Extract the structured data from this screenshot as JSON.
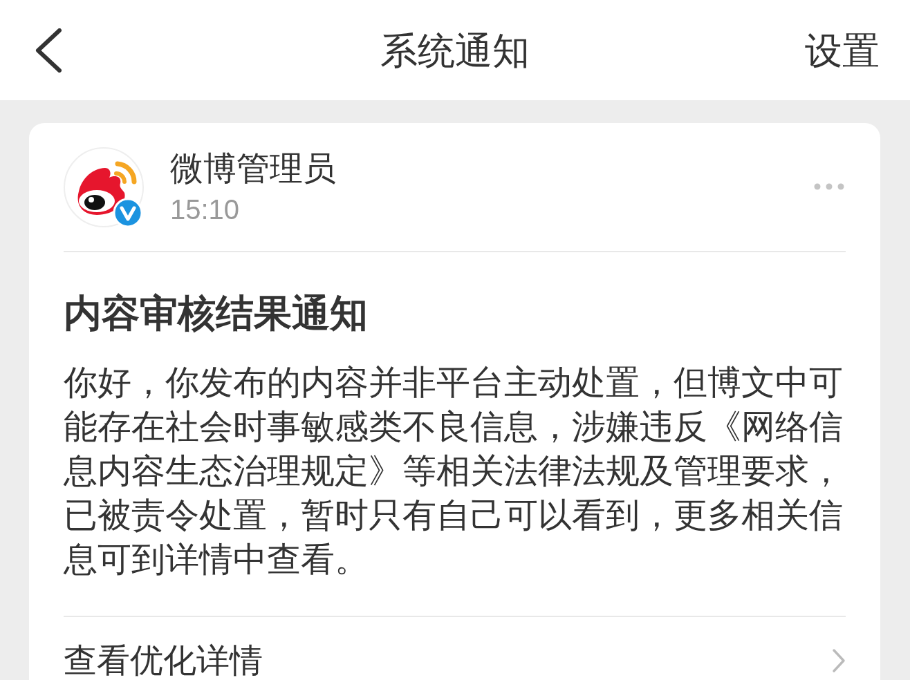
{
  "header": {
    "title": "系统通知",
    "action": "设置"
  },
  "notification": {
    "sender": {
      "name": "微博管理员",
      "verified": true,
      "time": "15:10"
    },
    "title": "内容审核结果通知",
    "body": "你好，你发布的内容并非平台主动处置，但博文中可能存在社会时事敏感类不良信息，涉嫌违反《网络信息内容生态治理规定》等相关法律法规及管理要求，已被责令处置，暂时只有自己可以看到，更多相关信息可到详情中查看。",
    "link": "查看优化详情"
  }
}
